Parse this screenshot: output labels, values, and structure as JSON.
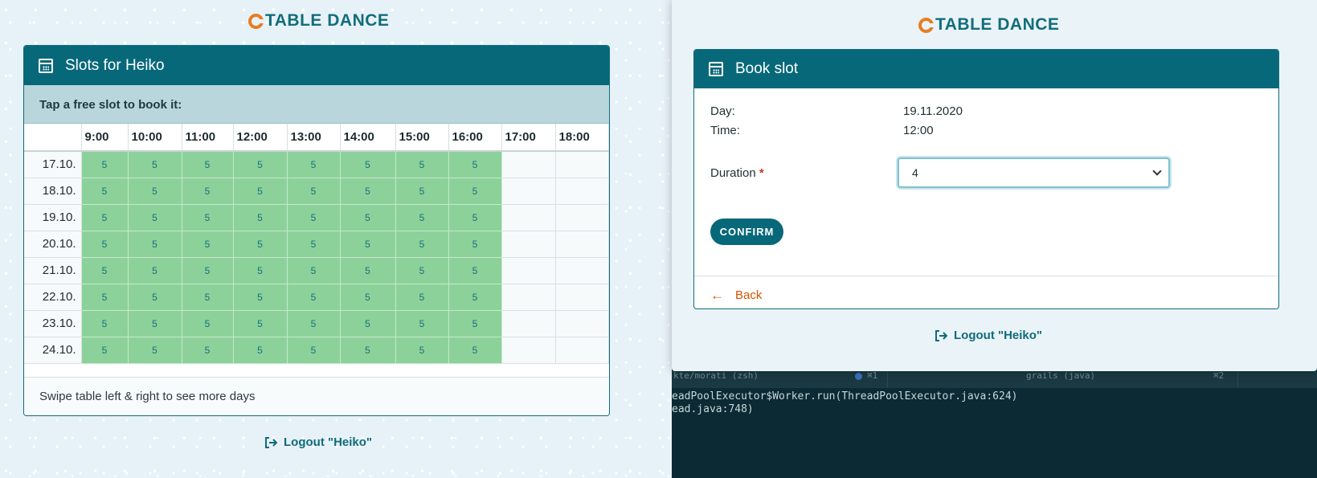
{
  "left": {
    "logo_text": "TABLE DANCE",
    "card_title": "Slots for Heiko",
    "instruction": "Tap a free slot to book it:",
    "hours": [
      "9:00",
      "10:00",
      "11:00",
      "12:00",
      "13:00",
      "14:00",
      "15:00",
      "16:00",
      "17:00",
      "18:00"
    ],
    "rows": [
      {
        "day": "17.10.",
        "cells": [
          "5",
          "5",
          "5",
          "5",
          "5",
          "5",
          "5",
          "5",
          "",
          ""
        ]
      },
      {
        "day": "18.10.",
        "cells": [
          "5",
          "5",
          "5",
          "5",
          "5",
          "5",
          "5",
          "5",
          "",
          ""
        ]
      },
      {
        "day": "19.10.",
        "cells": [
          "5",
          "5",
          "5",
          "5",
          "5",
          "5",
          "5",
          "5",
          "",
          ""
        ]
      },
      {
        "day": "20.10.",
        "cells": [
          "5",
          "5",
          "5",
          "5",
          "5",
          "5",
          "5",
          "5",
          "",
          ""
        ]
      },
      {
        "day": "21.10.",
        "cells": [
          "5",
          "5",
          "5",
          "5",
          "5",
          "5",
          "5",
          "5",
          "",
          ""
        ]
      },
      {
        "day": "22.10.",
        "cells": [
          "5",
          "5",
          "5",
          "5",
          "5",
          "5",
          "5",
          "5",
          "",
          ""
        ]
      },
      {
        "day": "23.10.",
        "cells": [
          "5",
          "5",
          "5",
          "5",
          "5",
          "5",
          "5",
          "5",
          "",
          ""
        ]
      },
      {
        "day": "24.10.",
        "cells": [
          "5",
          "5",
          "5",
          "5",
          "5",
          "5",
          "5",
          "5",
          "",
          ""
        ]
      }
    ],
    "swipe_hint": "Swipe table left & right to see more days",
    "logout_label": "Logout \"Heiko\""
  },
  "right": {
    "logo_text": "TABLE DANCE",
    "card_title": "Book slot",
    "day_label": "Day:",
    "day_value": "19.11.2020",
    "time_label": "Time:",
    "time_value": "12:00",
    "duration_label": "Duration",
    "duration_value": "4",
    "confirm_label": "CONFIRM",
    "back_label": "Back",
    "logout_label": "Logout \"Heiko\""
  },
  "terminal": {
    "tab1_label": "kte/morati (zsh)",
    "tab1_shortcut": "⌘1",
    "tab2_label": "grails (java)",
    "tab2_shortcut": "⌘2",
    "lines": [
      "eadPoolExecutor$Worker.run(ThreadPoolExecutor.java:624)",
      "ead.java:748)"
    ]
  },
  "colors": {
    "brand": "#07687a",
    "slot_free": "#8dd19a",
    "accent": "#e67e22",
    "back": "#d35400"
  }
}
